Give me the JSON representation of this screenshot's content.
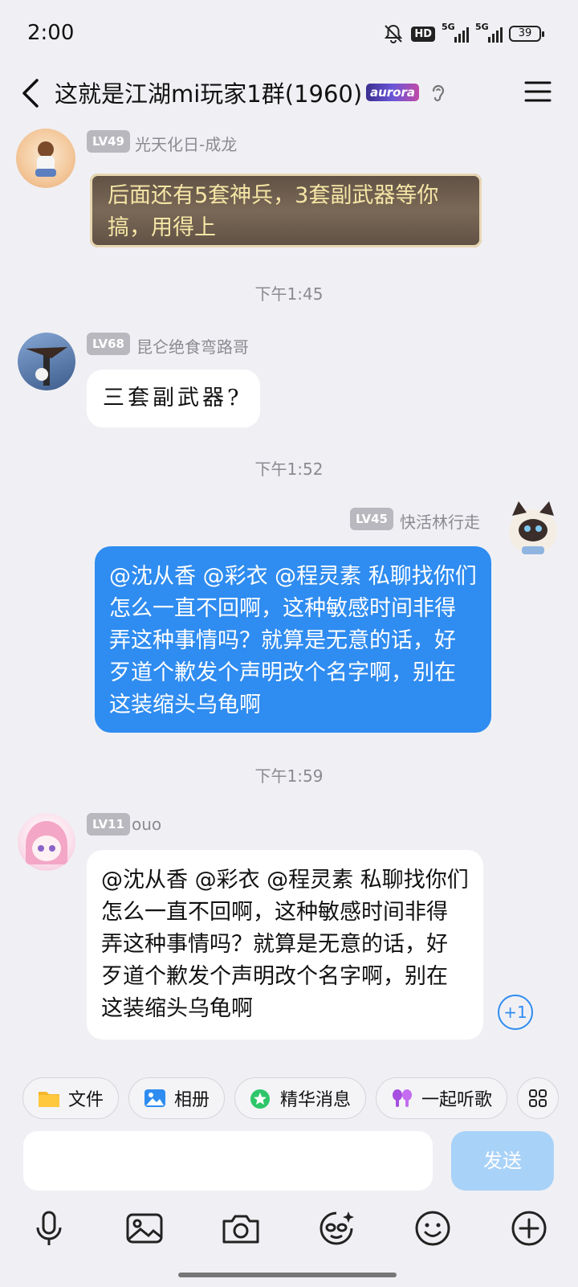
{
  "status_bar": {
    "time": "2:00",
    "battery": "39",
    "network_1": "5G",
    "network_2": "5G",
    "hd": "HD"
  },
  "header": {
    "title": "这就是江湖mi玩家1群(1960)",
    "badge": "aurora"
  },
  "messages": [
    {
      "level": "LV49",
      "sender": "光天化日-成龙",
      "text": "后面还有5套神兵，3套副武器等你搞，用得上"
    },
    {
      "level": "LV68",
      "sender": "昆仑绝食弯路哥",
      "text": "三套副武器?"
    },
    {
      "level": "LV45",
      "sender": "快活林行走",
      "text": "@沈从香 @彩衣 @程灵素 私聊找你们怎么一直不回啊，这种敏感时间非得弄这种事情吗？就算是无意的话，好歹道个歉发个声明改个名字啊，别在这装缩头乌龟啊"
    },
    {
      "level": "LV11",
      "sender": "ouo",
      "text": "@沈从香 @彩衣 @程灵素 私聊找你们怎么一直不回啊，这种敏感时间非得弄这种事情吗？就算是无意的话，好歹道个歉发个声明改个名字啊，别在这装缩头乌龟啊",
      "plus": "+1"
    }
  ],
  "timestamps": [
    "下午1:45",
    "下午1:52",
    "下午1:59"
  ],
  "quick_actions": [
    {
      "label": "文件",
      "icon": "folder-icon"
    },
    {
      "label": "相册",
      "icon": "photo-icon"
    },
    {
      "label": "精华消息",
      "icon": "star-icon"
    },
    {
      "label": "一起听歌",
      "icon": "earbuds-icon"
    }
  ],
  "input": {
    "send_label": "发送"
  },
  "colors": {
    "accent": "#2f8cf0",
    "send_disabled": "#a9d2f8",
    "background": "#f0f0f4"
  }
}
